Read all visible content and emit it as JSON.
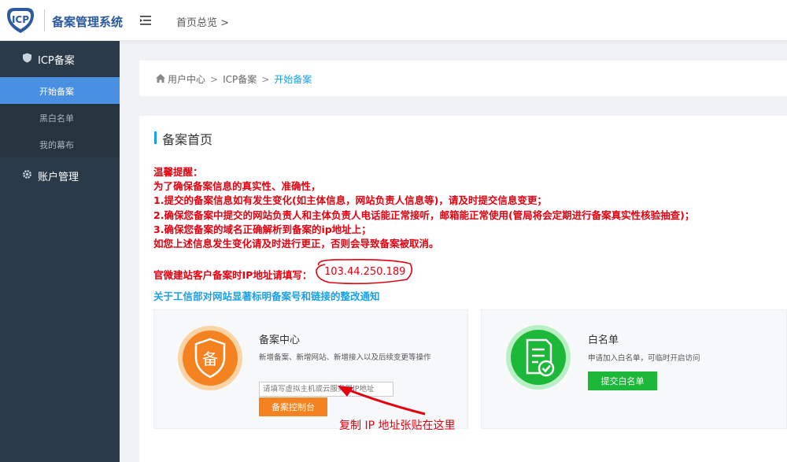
{
  "header": {
    "logo_text": "ICP",
    "app_name": "备案管理系统",
    "breadcrumb": "首页总览 >"
  },
  "sidebar": {
    "groups": [
      {
        "label": "ICP备案",
        "icon": "shield-icon",
        "items": [
          {
            "label": "开始备案",
            "active": true
          },
          {
            "label": "黑白名单",
            "active": false
          },
          {
            "label": "我的幕布",
            "active": false
          }
        ]
      },
      {
        "label": "账户管理",
        "icon": "gear-icon",
        "items": []
      }
    ]
  },
  "breadcrumb": {
    "items": [
      "用户中心",
      "ICP备案",
      "开始备案"
    ],
    "separator": ">"
  },
  "main": {
    "title": "备案首页",
    "notice_lines": [
      "温馨提醒：",
      "为了确保备案信息的真实性、准确性，",
      "1.提交的备案信息如有发生变化(如主体信息，网站负责人信息等)，请及时提交信息变更；",
      "2.确保您备案中提交的网站负责人和主体负责人电话能正常接听，邮箱能正常使用(管局将会定期进行备案真实性核验抽查)；",
      "3.确保您备案的域名正确解析到备案的ip地址上；",
      "如您上述信息发生变化请及时进行更正，否则会导致备案被取消。"
    ],
    "ip_label": "官微建站客户备案时IP地址请填写：",
    "ip_value": "103.44.250.189",
    "notice_link": "关于工信部对网站显著标明备案号和链接的整改通知",
    "panels": {
      "filing": {
        "title": "备案中心",
        "desc": "新增备案、新增网站、新增接入以及后续变更等操作",
        "badge_char": "备",
        "input_placeholder": "请填写虚拟主机或云服务器IP地址",
        "button": "备案控制台"
      },
      "whitelist": {
        "title": "白名单",
        "desc": "申请加入白名单，可临时开启访问",
        "button": "提交白名单"
      }
    },
    "annotation": "复制 IP 地址张贴在这里"
  },
  "colors": {
    "sidebar_bg": "#2b3a48",
    "active_nav": "#4a90e2",
    "accent_blue": "#1aa0e6",
    "notice_red": "#e4000f",
    "filing_orange": "#f58220",
    "whitelist_green": "#1db839"
  }
}
